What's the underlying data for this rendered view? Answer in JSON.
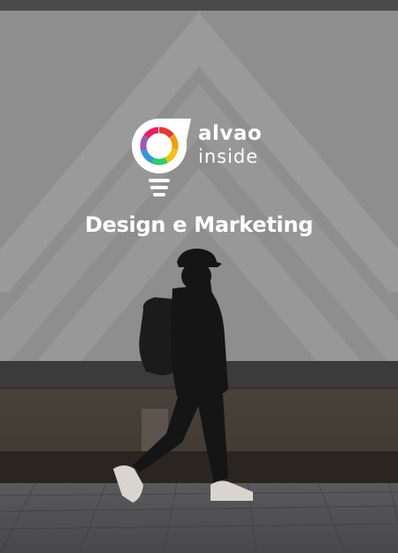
{
  "brand": {
    "name": "alvao",
    "tagline": "inside"
  },
  "headline": "Design e Marketing",
  "colors": {
    "billboard_gray": "#8f8f8f",
    "text": "#ffffff",
    "logo_ring": [
      "#e53935",
      "#f39c12",
      "#f1c40f",
      "#2ecc71",
      "#3498db",
      "#9b59b6",
      "#e91e63"
    ]
  }
}
